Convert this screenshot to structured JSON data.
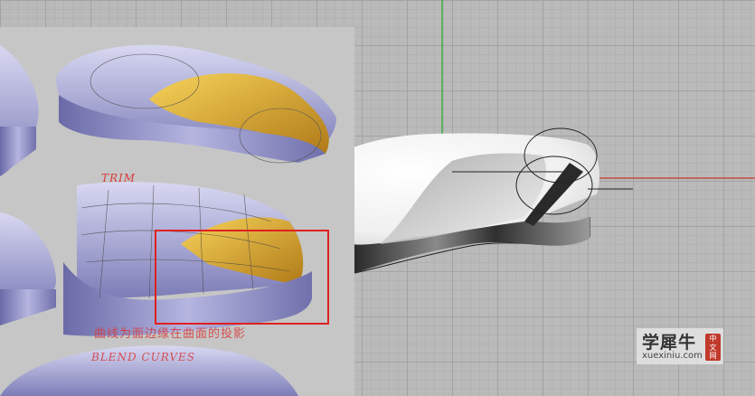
{
  "reference": {
    "trim_label": "TRIM",
    "note_label": "曲线为面边缘在曲面的投影",
    "blend_label": "BLEND CURVES"
  },
  "watermark": {
    "name": "学犀牛",
    "url": "xuexiniu.com",
    "badge": [
      "中",
      "文",
      "网"
    ]
  },
  "colors": {
    "x_axis": "#c0392b",
    "y_axis": "#3fae3f",
    "selection_box": "#e02020",
    "surface_lavender": "#a6a6d8",
    "surface_yellow": "#e8b23a"
  }
}
